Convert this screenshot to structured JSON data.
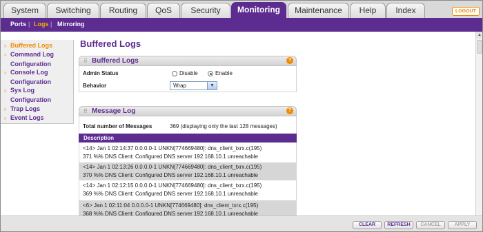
{
  "top_tabs": [
    {
      "label": "System"
    },
    {
      "label": "Switching"
    },
    {
      "label": "Routing"
    },
    {
      "label": "QoS"
    },
    {
      "label": "Security"
    },
    {
      "label": "Monitoring"
    },
    {
      "label": "Maintenance"
    },
    {
      "label": "Help"
    },
    {
      "label": "Index"
    }
  ],
  "active_tab": "Monitoring",
  "logout_label": "LOGOUT",
  "sub_nav": {
    "items": [
      {
        "label": "Ports"
      },
      {
        "label": "Logs"
      },
      {
        "label": "Mirroring"
      }
    ],
    "active": "Logs",
    "separator": "|"
  },
  "sidebar": {
    "items": [
      {
        "label": "Buffered Logs"
      },
      {
        "label": "Command Log",
        "label2": "Configuration"
      },
      {
        "label": "Console Log",
        "label2": "Configuration"
      },
      {
        "label": "Sys Log",
        "label2": "Configuration"
      },
      {
        "label": "Trap Logs"
      },
      {
        "label": "Event Logs"
      }
    ],
    "active": "Buffered Logs",
    "arrow": "›"
  },
  "page_title": "Buffered Logs",
  "buffered_panel": {
    "title": "Buffered Logs",
    "admin_status": {
      "label": "Admin Status",
      "options": [
        "Disable",
        "Enable"
      ],
      "selected": "Enable"
    },
    "behavior": {
      "label": "Behavior",
      "value": "Wrap"
    }
  },
  "message_panel": {
    "title": "Message Log",
    "total_label": "Total number of Messages",
    "total_value": "369 (displaying only the last 128 messages)",
    "column_header": "Description",
    "rows": [
      {
        "line1": "<14> Jan 1 02:14:37 0.0.0.0-1 UNKN[774669480]: dns_client_txrx.c(195)",
        "line2": "371 %% DNS Client: Configured DNS server 192.168.10.1 unreachable"
      },
      {
        "line1": "<14> Jan 1 02:13:26 0.0.0.0-1 UNKN[774669480]: dns_client_txrx.c(195)",
        "line2": "370 %% DNS Client: Configured DNS server 192.168.10.1 unreachable"
      },
      {
        "line1": "<14> Jan 1 02:12:15 0.0.0.0-1 UNKN[774669480]: dns_client_txrx.c(195)",
        "line2": "369 %% DNS Client: Configured DNS server 192.168.10.1 unreachable"
      },
      {
        "line1": "<6> Jan 1 02:11:04 0.0.0.0-1 UNKN[774669480]: dns_client_txrx.c(195)",
        "line2": "368 %% DNS Client: Configured DNS server 192.168.10.1 unreachable"
      }
    ]
  },
  "help_icon_glyph": "?",
  "bottom_buttons": [
    {
      "label": "CLEAR",
      "enabled": true
    },
    {
      "label": "REFRESH",
      "enabled": true
    },
    {
      "label": "CANCEL",
      "enabled": false
    },
    {
      "label": "APPLY",
      "enabled": false
    }
  ],
  "colors": {
    "brand_purple": "#5d2c91",
    "accent_orange": "#f08a00",
    "active_subnav": "#f9b000"
  }
}
